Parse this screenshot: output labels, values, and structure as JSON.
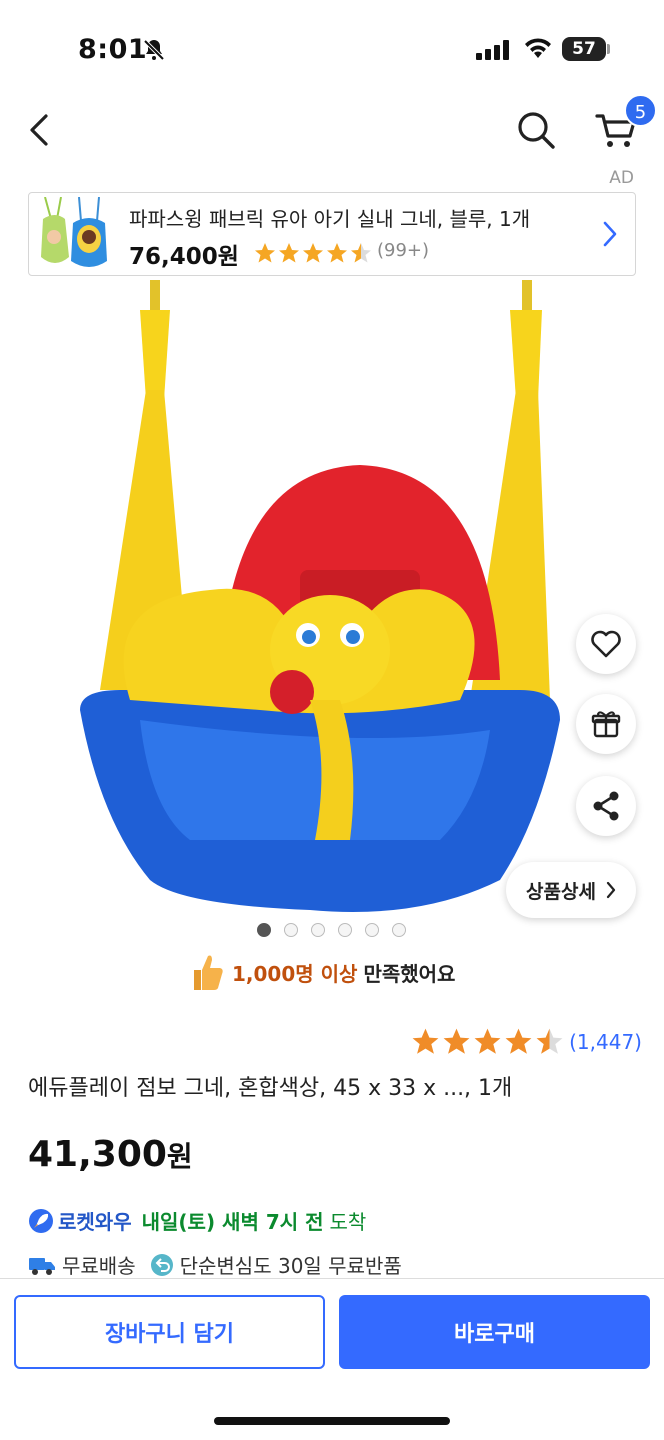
{
  "status_bar": {
    "time": "8:01",
    "battery": "57",
    "icons": [
      "bell-slash-icon",
      "signal-icon",
      "wifi-icon",
      "battery-icon"
    ]
  },
  "nav": {
    "cart_count": "5",
    "ad_label": "AD",
    "icons": [
      "back-icon",
      "search-icon",
      "cart-icon"
    ]
  },
  "ad": {
    "title": "파파스윙 패브릭 유아 아기 실내 그네, 블루, 1개",
    "price": "76,400원",
    "rating": 4.5,
    "review_count": "(99+)"
  },
  "actions": {
    "detail_label": "상품상세",
    "icons": [
      "heart-icon",
      "gift-icon",
      "share-icon"
    ]
  },
  "carousel": {
    "total": 6,
    "active": 0
  },
  "satisfaction": {
    "count": "1,000명 이상",
    "text": "만족했어요"
  },
  "product": {
    "rating": 4.5,
    "review_count": "(1,447)",
    "name": "에듀플레이 점보 그네, 혼합색상, 45 x 33 x ..., 1개",
    "price_number": "41,300",
    "price_unit": "원"
  },
  "delivery": {
    "badge": "로켓와우",
    "day": "내일(토) 새벽 7시 전",
    "suffix": "도착"
  },
  "shipping": {
    "free_shipping": "무료배송",
    "return_policy": "단순변심도 30일 무료반품"
  },
  "buttons": {
    "cart": "장바구니 담기",
    "buy": "바로구매"
  },
  "colors": {
    "accent": "#346aff",
    "badge": "#2f6bf0",
    "delivery_green": "#0b8a2e",
    "star_ad": "#f5a623",
    "star_product": "#f08c28"
  }
}
